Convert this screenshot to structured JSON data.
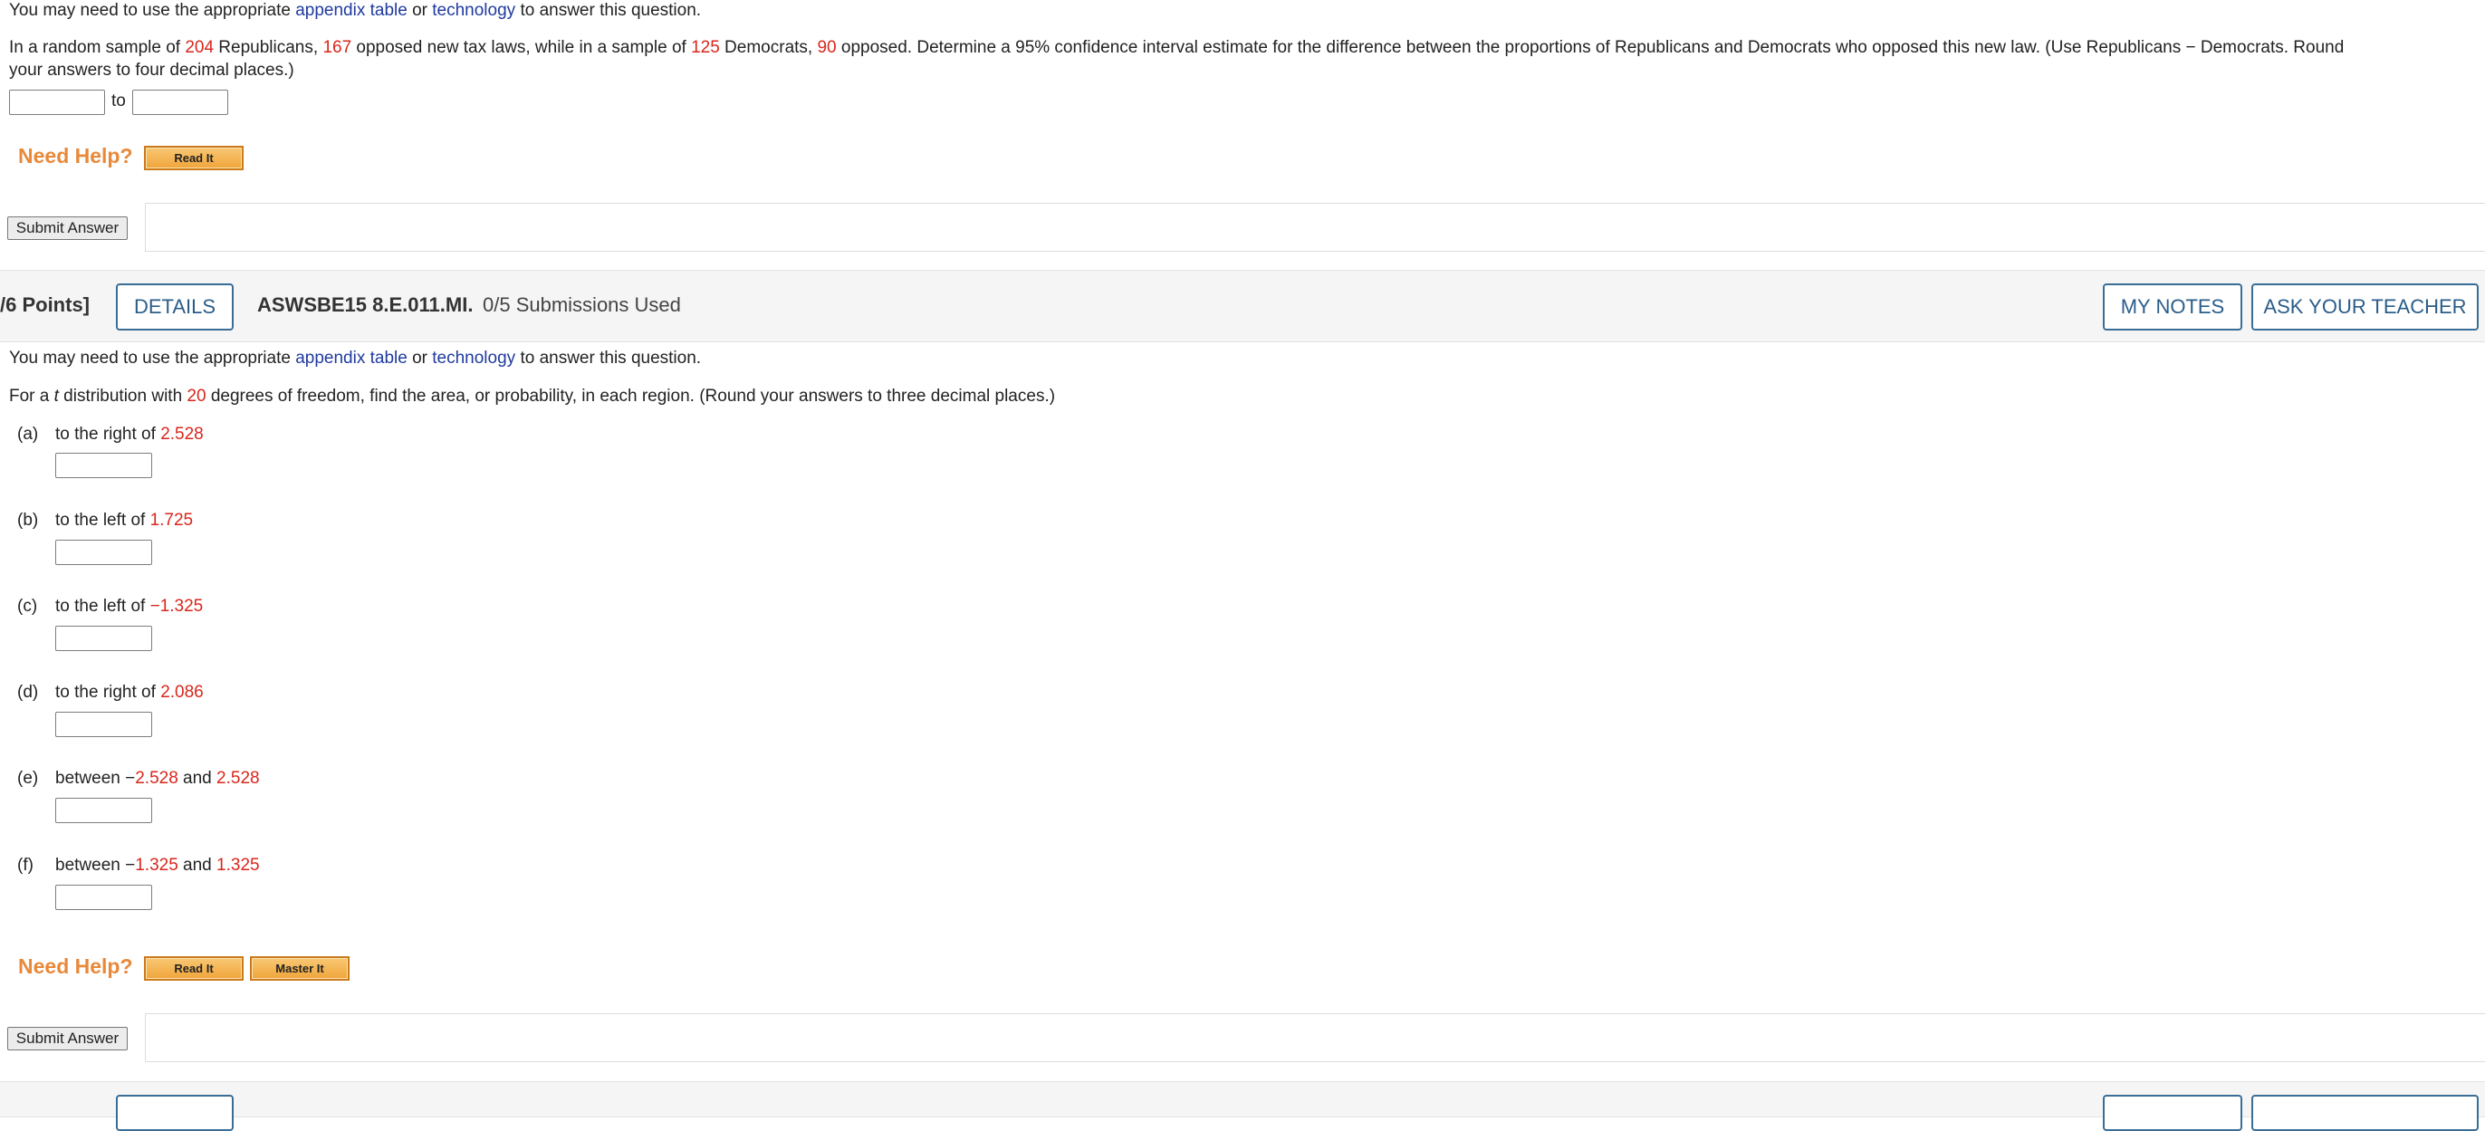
{
  "q1": {
    "intro_pre": "You may need to use the appropriate ",
    "link_table": "appendix table",
    "intro_or": " or ",
    "link_tech": "technology",
    "intro_post": " to answer this question.",
    "p1": "In a random sample of ",
    "n_rep": "204",
    "p2": " Republicans, ",
    "opp_rep": "167",
    "p3": " opposed new tax laws, while in a sample of ",
    "n_dem": "125",
    "p4": " Democrats, ",
    "opp_dem": "90",
    "p5": " opposed. Determine a 95% confidence interval estimate for the difference between the proportions of Republicans and Democrats who opposed this new law. (Use Republicans − Democrats. Round",
    "p6": "your answers to four decimal places.)",
    "to_label": "to",
    "input_lower": "",
    "input_upper": "",
    "need_help": "Need Help?",
    "read_it": "Read It",
    "submit": "Submit Answer"
  },
  "q2_header": {
    "points": "/6 Points]",
    "details": "DETAILS",
    "qid": "ASWSBE15 8.E.011.MI.",
    "submissions": "0/5 Submissions Used",
    "my_notes": "MY NOTES",
    "ask_teacher": "ASK YOUR TEACHER"
  },
  "q2": {
    "intro_pre": "You may need to use the appropriate ",
    "link_table": "appendix table",
    "intro_or": " or ",
    "link_tech": "technology",
    "intro_post": " to answer this question.",
    "s1": "For a ",
    "t": "t",
    "s2": " distribution with ",
    "df": "20",
    "s3": " degrees of freedom, find the area, or probability, in each region. (Round your answers to three decimal places.)",
    "parts": [
      {
        "label": "(a)",
        "text": "to the right of ",
        "v1": "2.528",
        "value": ""
      },
      {
        "label": "(b)",
        "text": "to the left of ",
        "v1": "1.725",
        "value": ""
      },
      {
        "label": "(c)",
        "text": "to the left of ",
        "v1": "−1.325",
        "value": ""
      },
      {
        "label": "(d)",
        "text": "to the right of ",
        "v1": "2.086",
        "value": ""
      },
      {
        "label": "(e)",
        "text": "between −",
        "v1": "2.528",
        "and": " and ",
        "v2": "2.528",
        "value": ""
      },
      {
        "label": "(f)",
        "text": "between −",
        "v1": "1.325",
        "and": " and ",
        "v2": "1.325",
        "value": ""
      }
    ],
    "need_help": "Need Help?",
    "read_it": "Read It",
    "master_it": "Master It",
    "submit": "Submit Answer"
  },
  "colors": {
    "accent_red": "#d9261c",
    "link_blue": "#1f3a9e",
    "help_orange": "#e8893a",
    "button_blue": "#2a5d89"
  }
}
